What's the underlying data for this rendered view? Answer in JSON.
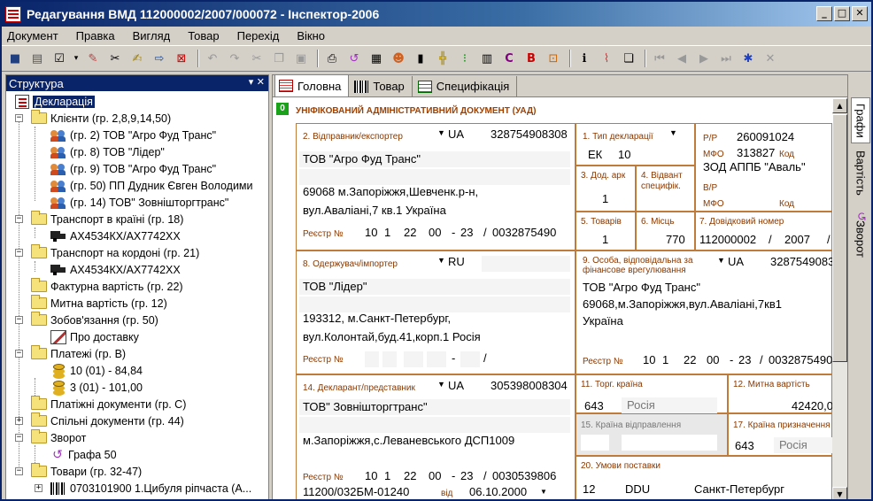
{
  "window": {
    "title": "Редагування ВМД 112000002/2007/000072 - Інспектор-2006",
    "btn_min": "_",
    "btn_max": "□",
    "btn_close": "✕"
  },
  "menu": [
    "Документ",
    "Правка",
    "Вигляд",
    "Товар",
    "Перехід",
    "Вікно"
  ],
  "left_panel": {
    "title": "Структура",
    "controls": "▾ ✕",
    "tree": [
      "Декларація",
      "Клієнти (гр. 2,8,9,14,50)",
      "(гр. 2) ТОВ \"Агро Фуд Транс\"",
      "(гр. 8) ТОВ \"Лідер\"",
      "(гр. 9) ТОВ \"Агро Фуд Транс\"",
      "(гр. 50) ПП Дудник Євген Володими",
      "(гр. 14) ТОВ\" Зовнішторгтранс\"",
      "Транспорт в країні (гр. 18)",
      "АХ4534КХ/АХ7742ХХ",
      "Транспорт на кордоні (гр. 21)",
      "АХ4534КХ/АХ7742ХХ",
      "Фактурна вартість (гр. 22)",
      "Митна вартість (гр. 12)",
      "Зобов'язання (гр. 50)",
      "Про доставку",
      "Платежі (гр. В)",
      "10 (01) - 84,84",
      "3 (01) - 101,00",
      "Платіжні документи (гр. С)",
      "Спільні документи (гр. 44)",
      "Зворот",
      "Графа 50",
      "Товари (гр. 32-47)",
      "0703101900 1.Цибуля ріпчаста (А..."
    ]
  },
  "tabs": [
    "Головна",
    "Товар",
    "Специфікація"
  ],
  "side_tabs": [
    "Графи",
    "Вартість",
    "Зворот"
  ],
  "form": {
    "badge": "0",
    "doc_title": "УНІФІКОВАНИЙ АДМІНІСТРАТИВНИЙ ДОКУМЕНТ (УАД)",
    "g2": {
      "label": "2. Відправник/експортер",
      "country": "UA",
      "code": "328754908308",
      "name": "ТОВ \"Агро Фуд Транс\"",
      "addr1": "69068 м.Запоріжжя,Шевченк.р-н,",
      "addr2": "вул.Аваліані,7 кв.1 Україна",
      "reg_label": "Реєстр №",
      "reg": [
        "10",
        "1",
        "22",
        "00",
        "-",
        "23",
        "/",
        "0032875490"
      ]
    },
    "g1": {
      "label": "1. Тип декларації",
      "v1": "ЕК",
      "v2": "10"
    },
    "bank": {
      "rr_label": "Р/Р",
      "rr": "260091024",
      "mfo_label": "МФО",
      "mfo": "313827",
      "code_label": "Код",
      "bank_name": "ЗОД АППБ \"Аваль\"",
      "vr_label": "В/Р",
      "mfo2_label": "МФО",
      "code2_label": "Код"
    },
    "g3": {
      "label": "3. Дод. арк",
      "value": "1"
    },
    "g4": {
      "label": "4. Відвант специфік."
    },
    "g5": {
      "label": "5. Товарів",
      "value": "1"
    },
    "g6": {
      "label": "6. Місць",
      "value": "770"
    },
    "g7": {
      "label": "7. Довідковий номер",
      "v1": "112000002",
      "sep": "/",
      "v2": "2007",
      "sep2": "/"
    },
    "g8": {
      "label": "8. Одержувач/імпортер",
      "country": "RU",
      "name": "ТОВ \"Лідер\"",
      "addr1": "193312, м.Санкт-Петербург,",
      "addr2": "вул.Колонтай,буд.41,корп.1 Росія",
      "reg_label": "Реєстр №",
      "reg_dash": "-",
      "reg_slash": "/"
    },
    "g9": {
      "label": "9. Особа, відповідальна за фінансове врегулювання",
      "country": "UA",
      "code": "3287549083",
      "name": "ТОВ \"Агро Фуд Транс\"",
      "addr1": "69068,м.Запоріжжя,вул.Аваліані,7кв1",
      "addr2": "Україна",
      "reg_label": "Реєстр №",
      "reg": [
        "10",
        "1",
        "22",
        "00",
        "-",
        "23",
        "/",
        "00328754908"
      ]
    },
    "g14": {
      "label": "14. Декларант/представник",
      "country": "UA",
      "code": "305398008304",
      "name": "ТОВ\" Зовнішторгтранс\"",
      "addr1": "м.Запоріжжя,с.Леванeвського ДСП1009",
      "reg_label": "Реєстр №",
      "reg": [
        "10",
        "1",
        "22",
        "00",
        "-",
        "23",
        "/",
        "0030539806"
      ],
      "cert": "11200/032БМ-01240",
      "from_label": "від",
      "date": "06.10.2000"
    },
    "g11": {
      "label": "11. Торг. країна",
      "code": "643",
      "name": "Росія"
    },
    "g12": {
      "label": "12. Митна вартість",
      "value": "42420,0"
    },
    "g15": {
      "label": "15. Країна відправлення"
    },
    "g17": {
      "label": "17. Країна призначення",
      "code": "643",
      "name": "Росія"
    },
    "g20": {
      "label": "20. Умови поставки",
      "v1": "12",
      "v2": "DDU",
      "v3": "Санкт-Петербург"
    }
  }
}
